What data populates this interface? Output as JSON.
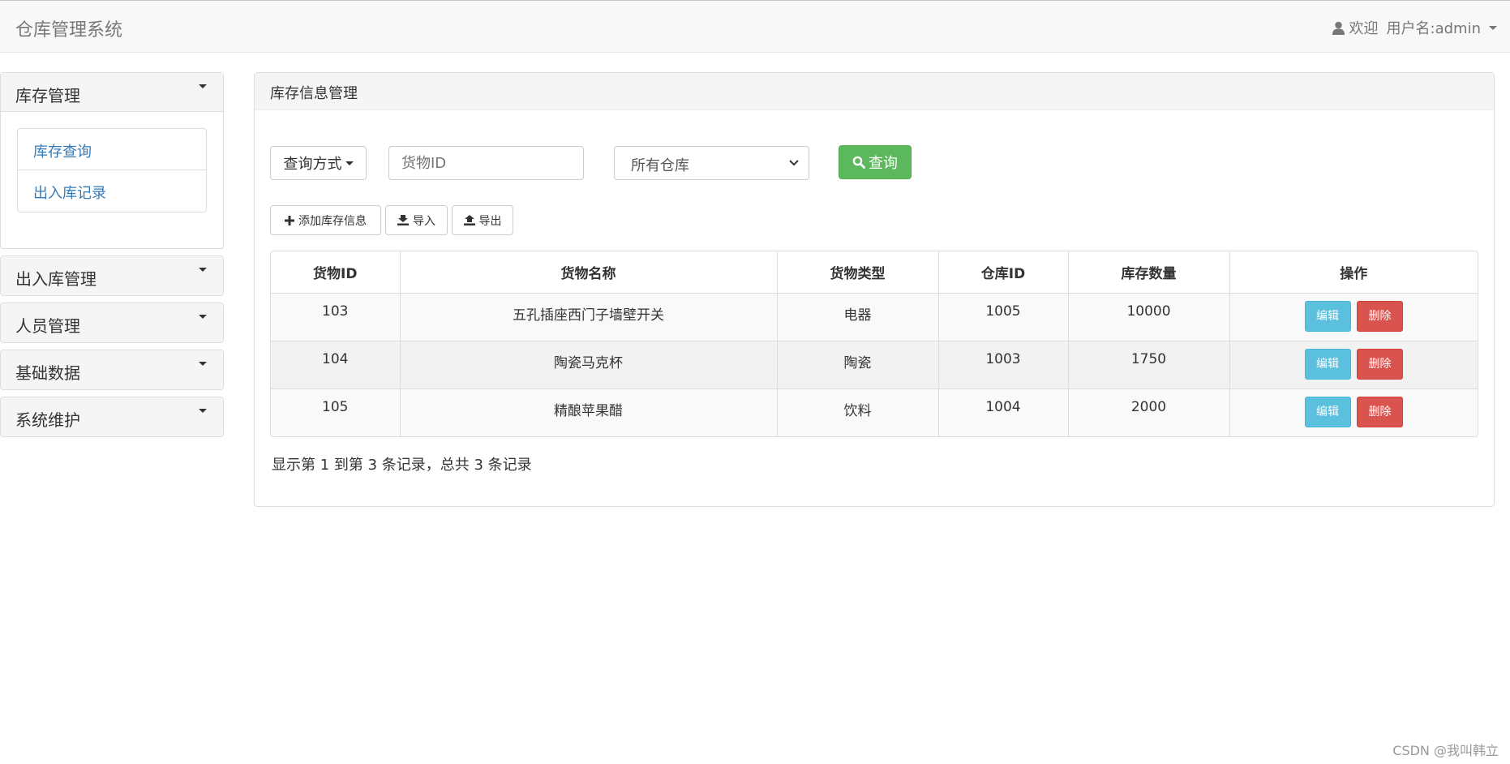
{
  "navbar": {
    "brand": "仓库管理系统",
    "welcome": "欢迎",
    "username": "用户名:admin"
  },
  "sidebar": {
    "groups": [
      {
        "title": "库存管理",
        "expanded": true,
        "items": [
          "库存查询",
          "出入库记录"
        ]
      },
      {
        "title": "出入库管理",
        "expanded": false
      },
      {
        "title": "人员管理",
        "expanded": false
      },
      {
        "title": "基础数据",
        "expanded": false
      },
      {
        "title": "系统维护",
        "expanded": false
      }
    ]
  },
  "main": {
    "title": "库存信息管理",
    "query_mode_label": "查询方式",
    "search_placeholder": "货物ID",
    "warehouse_select": "所有仓库",
    "search_label": "查询",
    "toolbar": {
      "add_label": "添加库存信息",
      "import_label": "导入",
      "export_label": "导出"
    },
    "table": {
      "headers": [
        "货物ID",
        "货物名称",
        "货物类型",
        "仓库ID",
        "库存数量",
        "操作"
      ],
      "rows": [
        {
          "goods_id": "103",
          "name": "五孔插座西门子墙壁开关",
          "type": "电器",
          "warehouse_id": "1005",
          "quantity": "10000"
        },
        {
          "goods_id": "104",
          "name": "陶瓷马克杯",
          "type": "陶瓷",
          "warehouse_id": "1003",
          "quantity": "1750"
        },
        {
          "goods_id": "105",
          "name": "精酿苹果醋",
          "type": "饮料",
          "warehouse_id": "1004",
          "quantity": "2000"
        }
      ],
      "edit_label": "编辑",
      "delete_label": "删除"
    },
    "pagination_info": "显示第 1 到第 3 条记录，总共 3 条记录"
  },
  "watermark": "CSDN @我叫韩立",
  "colors": {
    "success": "#5cb85c",
    "info": "#5bc0de",
    "danger": "#d9534f",
    "link": "#337ab7"
  }
}
